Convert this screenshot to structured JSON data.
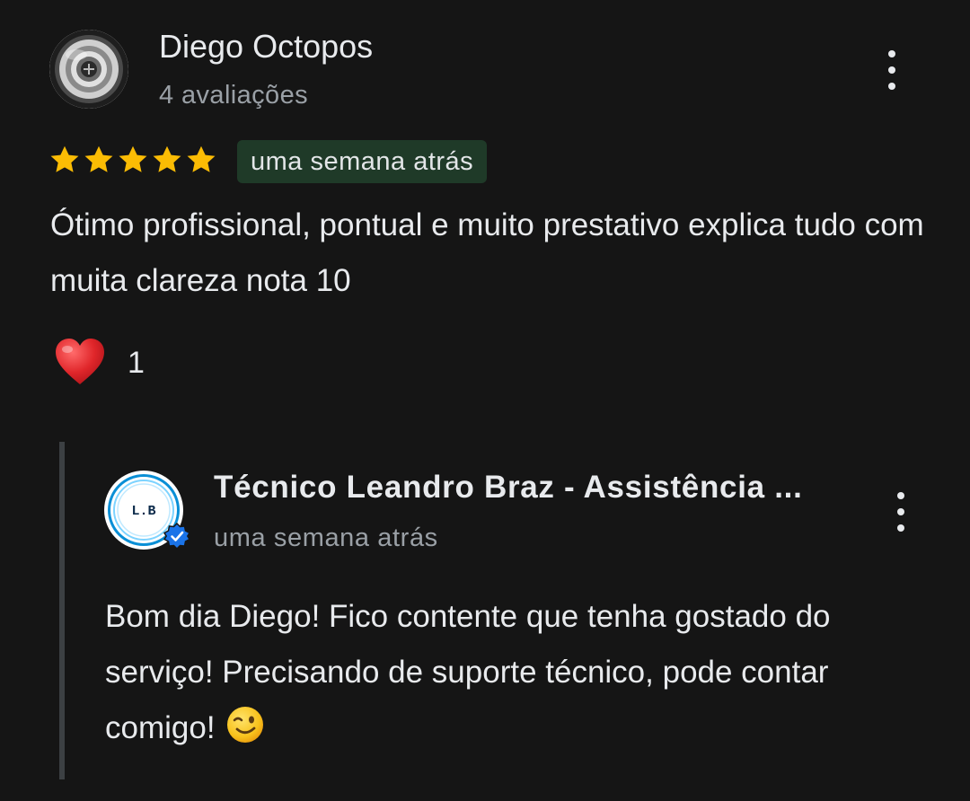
{
  "review": {
    "author_name": "Diego Octopos",
    "author_reviews": "4 avaliações",
    "rating": 5,
    "rating_max": 5,
    "time_chip": "uma semana atrás",
    "text": "Ótimo profissional, pontual e muito prestativo explica tudo com muita clareza nota 10",
    "reaction_icon": "heart-icon",
    "reaction_count": "1"
  },
  "reply": {
    "author_name": "Técnico Leandro Braz - Assistência ...",
    "avatar_text": "L.B",
    "verified": true,
    "time": "uma semana atrás",
    "text": "Bom dia Diego! Fico contente que tenha gostado do serviço! Precisando de suporte técnico, pode contar comigo!",
    "emoji_icon": "winking-face-icon"
  },
  "colors": {
    "background": "#151515",
    "star": "#fbbc04",
    "chip_bg": "#1f3a28",
    "secondary_text": "#9aa0a6",
    "verified_badge": "#1a73e8",
    "heart": "#e53935"
  },
  "icons": {
    "menu": "more-vertical-icon",
    "verified": "verified-badge-icon",
    "star": "star-icon"
  }
}
